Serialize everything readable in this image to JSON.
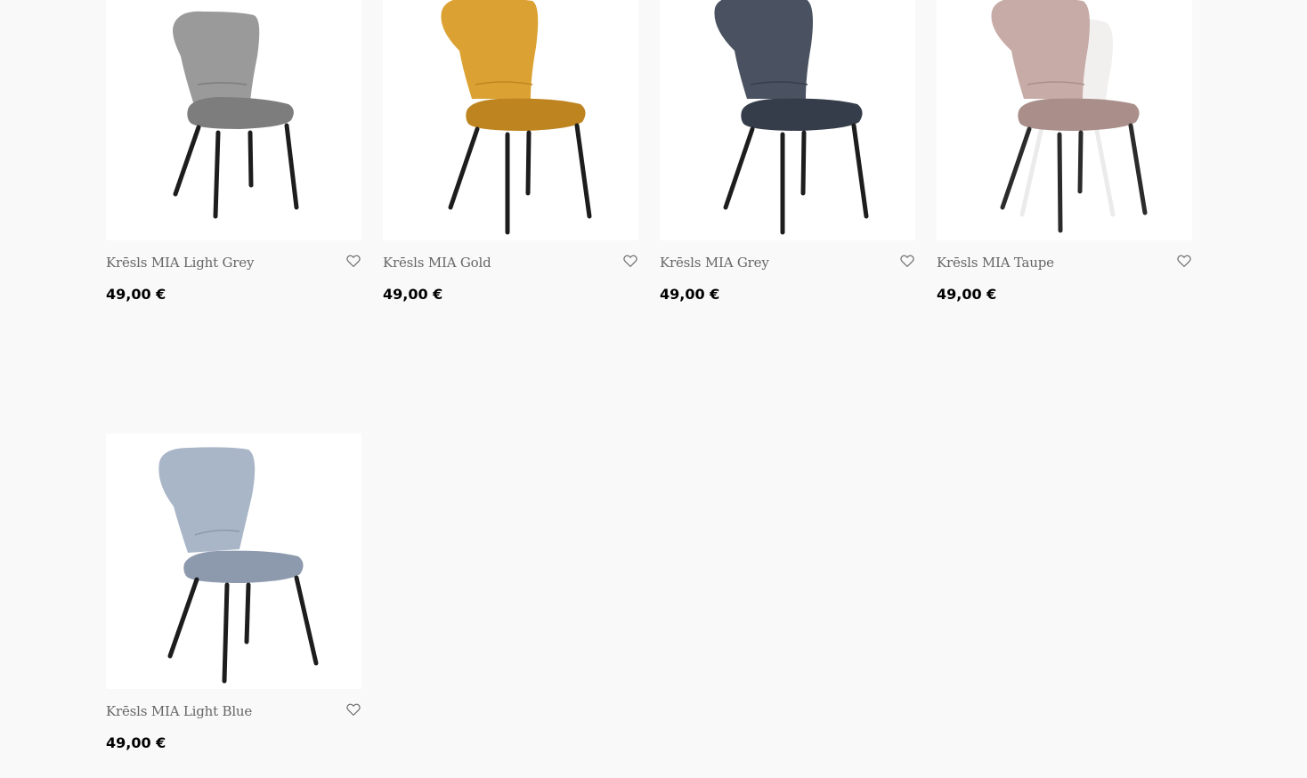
{
  "products": [
    {
      "title": "Krēsls MIA Light Grey",
      "price": "49,00 €",
      "icon": "heart-outline-icon",
      "color": "#9a9a9a",
      "shade": "#7d7d7d"
    },
    {
      "title": "Krēsls MIA Gold",
      "price": "49,00 €",
      "icon": "heart-outline-icon",
      "color": "#dba233",
      "shade": "#bd8420"
    },
    {
      "title": "Krēsls MIA Grey",
      "price": "49,00 €",
      "icon": "heart-outline-icon",
      "color": "#4a5261",
      "shade": "#363d4a"
    },
    {
      "title": "Krēsls MIA Taupe",
      "price": "49,00 €",
      "icon": "heart-outline-icon",
      "color": "#c7aba6",
      "shade": "#a98e89"
    },
    {
      "title": "Krēsls MIA Light Blue",
      "price": "49,00 €",
      "icon": "heart-outline-icon",
      "color": "#a9b6c8",
      "shade": "#8d9aae"
    }
  ]
}
